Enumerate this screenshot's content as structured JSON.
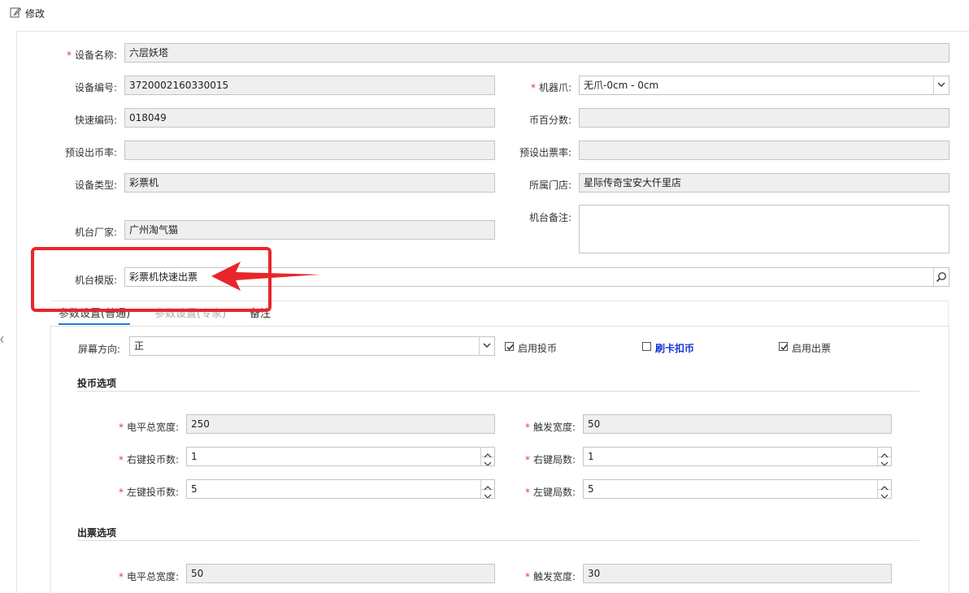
{
  "header": {
    "title": "修改",
    "icon": "edit-icon"
  },
  "form": {
    "device_name": {
      "label": "设备名称:",
      "value": "六层妖塔",
      "required": true
    },
    "device_no": {
      "label": "设备编号:",
      "value": "3720002160330015"
    },
    "claw": {
      "label": "机器爪:",
      "value": "无爪-0cm - 0cm",
      "required": true
    },
    "quick_code": {
      "label": "快速编码:",
      "value": "018049"
    },
    "coin_percent": {
      "label": "币百分数:",
      "value": ""
    },
    "preset_coin_rate": {
      "label": "预设出币率:",
      "value": ""
    },
    "preset_ticket_rate": {
      "label": "预设出票率:",
      "value": ""
    },
    "device_type": {
      "label": "设备类型:",
      "value": "彩票机"
    },
    "store": {
      "label": "所属门店:",
      "value": "星际传奇宝安大仟里店"
    },
    "manufacturer": {
      "label": "机台厂家:",
      "value": "广州淘气猫"
    },
    "remark": {
      "label": "机台备注:",
      "value": ""
    },
    "template": {
      "label": "机台模版:",
      "value": "彩票机快速出票"
    }
  },
  "tabs": [
    {
      "label": "参数设置(普通)",
      "active": true
    },
    {
      "label": "参数设置(专家)",
      "active": false
    },
    {
      "label": "备注",
      "active": false
    }
  ],
  "params": {
    "screen_dir": {
      "label": "屏幕方向:",
      "value": "正"
    },
    "enable_coin": {
      "label": "启用投币",
      "checked": true
    },
    "card_deduct": {
      "label": "刷卡扣币",
      "checked": false
    },
    "enable_ticket": {
      "label": "启用出票",
      "checked": true
    },
    "coin_section": "投币选项",
    "coin_level_width": {
      "label": "电平总宽度:",
      "value": "250",
      "required": true
    },
    "coin_trigger_width": {
      "label": "触发宽度:",
      "value": "50",
      "required": true
    },
    "right_coin": {
      "label": "右键投币数:",
      "value": "1",
      "required": true
    },
    "right_rounds": {
      "label": "右键局数:",
      "value": "1",
      "required": true
    },
    "left_coin": {
      "label": "左键投币数:",
      "value": "5",
      "required": true
    },
    "left_rounds": {
      "label": "左键局数:",
      "value": "5",
      "required": true
    },
    "ticket_section": "出票选项",
    "ticket_level_width": {
      "label": "电平总宽度:",
      "value": "50",
      "required": true
    },
    "ticket_trigger_width": {
      "label": "触发宽度:",
      "value": "30",
      "required": true
    }
  },
  "colors": {
    "highlight": "#e8262a",
    "accent": "#1e7ad6",
    "link": "#1433d6"
  }
}
